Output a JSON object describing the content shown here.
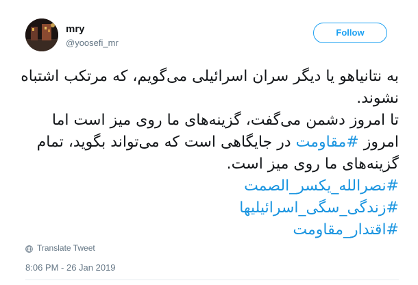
{
  "author": {
    "display_name": "mry",
    "handle": "@yoosefi_mr"
  },
  "follow_label": "Follow",
  "tweet": {
    "lines": [
      {
        "text": "به نتانیاهو یا دیگر سران اسرائیلی می‌گویم، که مرتکب اشتباه"
      },
      {
        "text": "نشوند."
      },
      {
        "text": "تا امروز دشمن می‌گفت، گزینه‌های ما روی میز است اما"
      },
      {
        "pre": "امروز ",
        "tag": "#مقاومت",
        "post": " در جایگاهی است که می‌تواند بگوید، تمام"
      },
      {
        "text": "گزینه‌های ما روی میز است."
      },
      {
        "tag": "#نصرالله_یکسر_الصمت"
      },
      {
        "tag": "#زندگی_سگی_اسرائیلیها"
      },
      {
        "tag": "#اقتدار_مقاومت"
      }
    ]
  },
  "translate_label": "Translate Tweet",
  "timestamp": "8:06 PM - 26 Jan 2019",
  "colors": {
    "link": "#1b95e0",
    "follow": "#1da1f2",
    "muted": "#657786"
  },
  "icons": {
    "translate": "globe-icon",
    "avatar": "profile-photo"
  }
}
